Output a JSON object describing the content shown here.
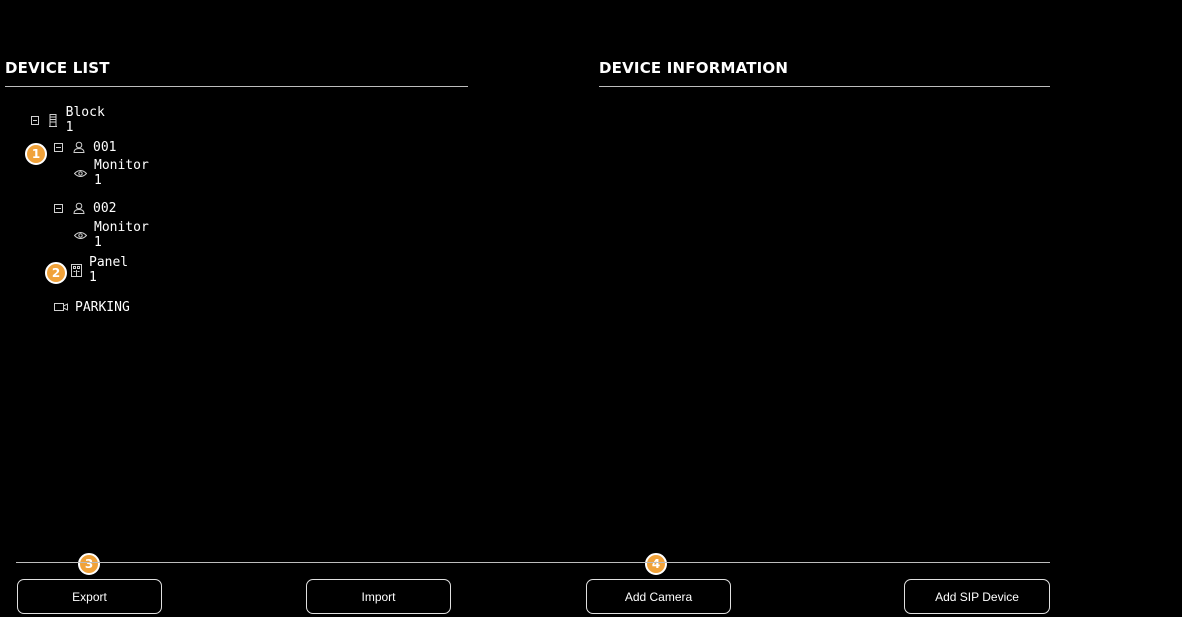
{
  "device_list": {
    "title": "DEVICE LIST",
    "tree": {
      "block": {
        "label": "Block 1",
        "icon": "building-icon"
      },
      "unit_001": {
        "label": "001",
        "icon": "user-icon"
      },
      "unit_001_monitor": {
        "label": "Monitor 1",
        "icon": "eye-icon"
      },
      "unit_002": {
        "label": "002",
        "icon": "user-icon"
      },
      "unit_002_monitor": {
        "label": "Monitor 1",
        "icon": "eye-icon"
      },
      "panel": {
        "label": "Panel 1",
        "icon": "door-panel-icon"
      },
      "camera": {
        "label": "PARKING",
        "icon": "camera-icon"
      }
    }
  },
  "device_information": {
    "title": "DEVICE INFORMATION"
  },
  "callouts": {
    "one": "1",
    "two": "2",
    "three": "3",
    "four": "4",
    "color": "#f0a23a"
  },
  "buttons": {
    "export": "Export",
    "import": "Import",
    "add_camera": "Add Camera",
    "add_sip_device": "Add SIP Device"
  }
}
